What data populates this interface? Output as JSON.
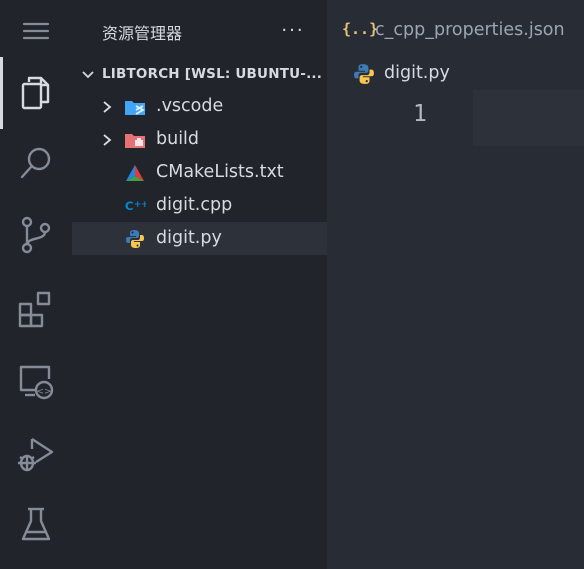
{
  "sidebar": {
    "title": "资源管理器",
    "more_label": "···",
    "section_label": "LIBTORCH [WSL: UBUNTU-...",
    "items": [
      {
        "label": ".vscode",
        "icon": "vscode-folder-icon",
        "kind": "folder"
      },
      {
        "label": "build",
        "icon": "build-folder-icon",
        "kind": "folder"
      },
      {
        "label": "CMakeLists.txt",
        "icon": "cmake-icon",
        "kind": "file"
      },
      {
        "label": "digit.cpp",
        "icon": "cpp-icon",
        "kind": "file"
      },
      {
        "label": "digit.py",
        "icon": "python-icon",
        "kind": "file",
        "selected": true
      }
    ]
  },
  "activity_bar": {
    "items": [
      "menu-icon",
      "explorer-icon",
      "search-icon",
      "source-control-icon",
      "extensions-icon",
      "remote-explorer-icon",
      "run-debug-icon",
      "testing-icon"
    ]
  },
  "editor": {
    "tab_icon": "{..}",
    "tab_label": "c_cpp_properties.json",
    "breadcrumb_label": "digit.py",
    "line_number": "1"
  },
  "colors": {
    "background": "#282c34",
    "sidebar": "#21252b",
    "selected_row": "#2c313a",
    "json_icon": "#e5c07b",
    "vscode_folder": "#42a5f5",
    "build_folder": "#e57373",
    "cpp": "#0288d1"
  }
}
